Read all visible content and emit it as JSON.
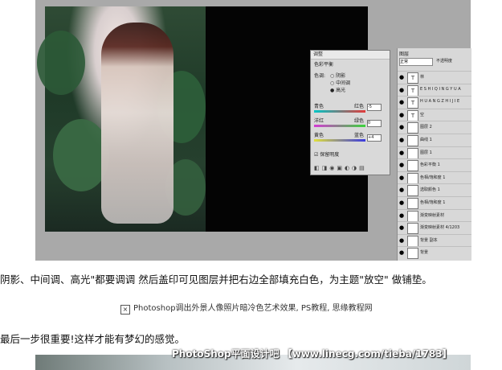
{
  "panel": {
    "title": "调整",
    "subtitle": "色彩平衡",
    "tone_label": "色调:",
    "tone_options": [
      "阴影",
      "中间调",
      "高光"
    ],
    "sliders": [
      {
        "left": "青色",
        "right": "红色",
        "value": "-5",
        "color_left": "#00c6c6",
        "color_right": "#e23a3a"
      },
      {
        "left": "洋红",
        "right": "绿色",
        "value": "0",
        "color_left": "#d43ad4",
        "color_right": "#3ad43a"
      },
      {
        "left": "黄色",
        "right": "蓝色",
        "value": "+4",
        "color_left": "#e0e03a",
        "color_right": "#3a3ae0"
      }
    ],
    "preserve_label": "保留明度"
  },
  "layers": {
    "blend_mode": "正常",
    "opacity_label": "不透明度",
    "items": [
      {
        "thumb": "T",
        "name": "林"
      },
      {
        "thumb": "T",
        "name": "E S H I Q I N G Y U A"
      },
      {
        "thumb": "T",
        "name": "H U A N G Z H I J I E"
      },
      {
        "thumb": "T",
        "name": "空"
      },
      {
        "thumb": "",
        "name": "图层 2"
      },
      {
        "thumb": "",
        "name": "曲线 1"
      },
      {
        "thumb": "",
        "name": "图层 1"
      },
      {
        "thumb": "",
        "name": "色彩平衡 1"
      },
      {
        "thumb": "",
        "name": "色相/饱和度 1"
      },
      {
        "thumb": "",
        "name": "选取颜色 1"
      },
      {
        "thumb": "",
        "name": "色相/饱和度 1"
      },
      {
        "thumb": "",
        "name": "渐变映射素材"
      },
      {
        "thumb": "",
        "name": "渐变映射素材 4/1203"
      },
      {
        "thumb": "",
        "name": "背景 副本"
      },
      {
        "thumb": "",
        "name": "背景"
      }
    ]
  },
  "text": {
    "line1": "阴影、中间调、高光\"都要调调 然后盖印可见图层并把右边全部填充白色，为主题\"放空\" 做铺垫。",
    "caption": "Photoshop调出外景人像照片暗冷色艺术效果, PS教程, 思缘教程网",
    "line2": "最后一步很重要!这样才能有梦幻的感觉。",
    "watermark": "PhotoShop平面设计吧 【www.linecg.com/tieba/1783】"
  }
}
